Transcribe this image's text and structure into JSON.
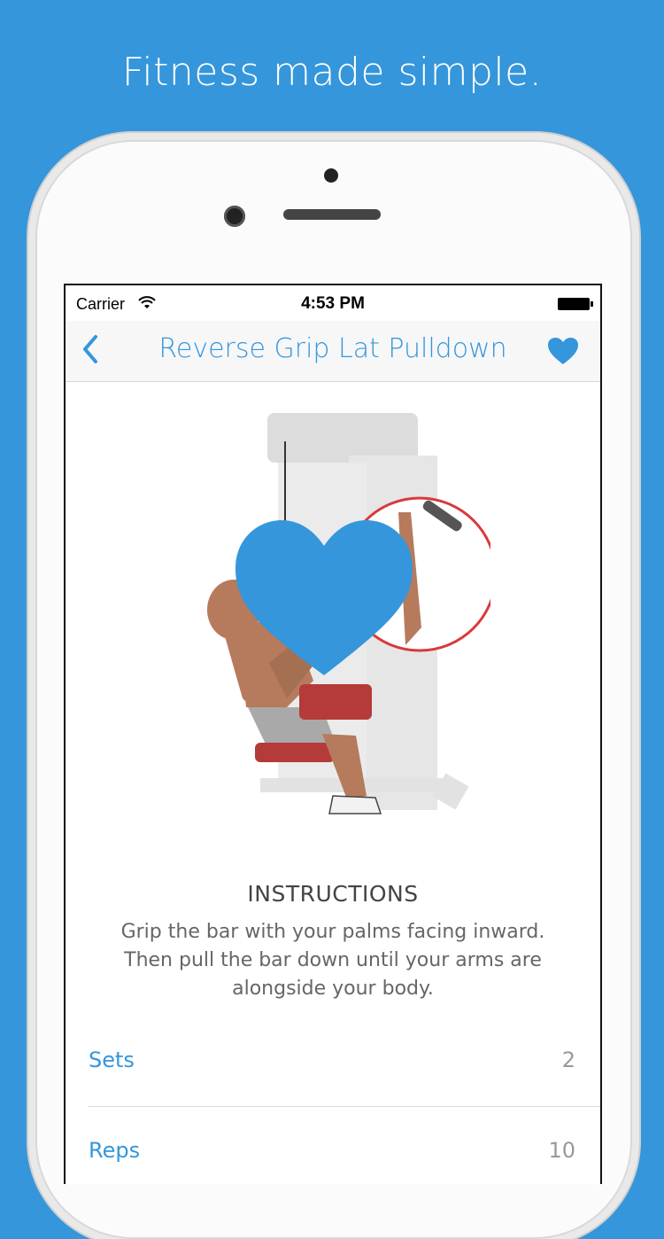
{
  "headline": "Fitness made simple.",
  "status": {
    "carrier": "Carrier",
    "time": "4:53 PM"
  },
  "nav": {
    "title": "Reverse Grip Lat Pulldown"
  },
  "instructions": {
    "heading": "INSTRUCTIONS",
    "text": "Grip the bar with your palms facing inward. Then pull the bar down until your arms are alongside your body."
  },
  "stats": [
    {
      "label": "Sets",
      "value": "2"
    },
    {
      "label": "Reps",
      "value": "10"
    }
  ],
  "colors": {
    "accent": "#3596db",
    "background": "#3596db",
    "highlight_ring": "#d9393a"
  },
  "icons": {
    "back": "chevron-left-icon",
    "favorite": "heart-icon",
    "wifi": "wifi-icon",
    "battery": "battery-icon"
  }
}
